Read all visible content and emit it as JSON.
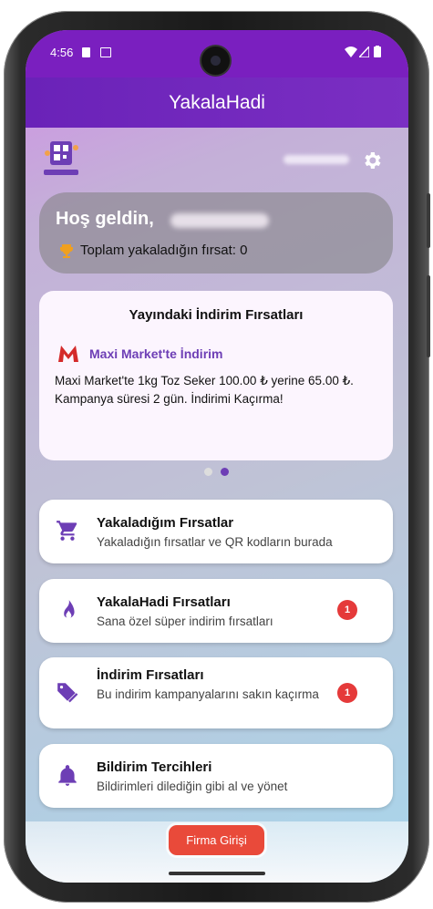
{
  "status_bar": {
    "time": "4:56"
  },
  "app_bar": {
    "title": "YakalaHadi"
  },
  "welcome": {
    "greeting": "Hoş geldin,",
    "total_caught": "Toplam yakaladığın fırsat: 0"
  },
  "promo": {
    "title": "Yayındaki İndirim Fırsatları",
    "brand": "Maxi Market'te İndirim",
    "description": "Maxi Market'te 1kg Toz Seker 100.00 ₺ yerine 65.00 ₺. Kampanya süresi 2 gün. İndirimi Kaçırma!",
    "pages": 2,
    "active_page": 2
  },
  "menu": [
    {
      "title": "Yakaladığım Fırsatlar",
      "subtitle": "Yakaladığın fırsatlar ve QR kodların burada",
      "icon": "cart-icon"
    },
    {
      "title": "YakalaHadi Fırsatları",
      "subtitle": "Sana özel süper indirim fırsatları",
      "icon": "flame-icon",
      "badge": "1"
    },
    {
      "title": "İndirim Fırsatları",
      "subtitle": "Bu indirim kampanyalarını sakın kaçırma",
      "icon": "tag-icon",
      "badge": "1"
    },
    {
      "title": "Bildirim Tercihleri",
      "subtitle": "Bildirimleri dilediğin gibi al ve yönet",
      "icon": "bell-icon"
    }
  ],
  "firma_button": "Firma Girişi",
  "colors": {
    "primary": "#7a1fbf",
    "accent": "#6d3eb5",
    "badge": "#e53a3a",
    "button": "#e94a3a"
  }
}
